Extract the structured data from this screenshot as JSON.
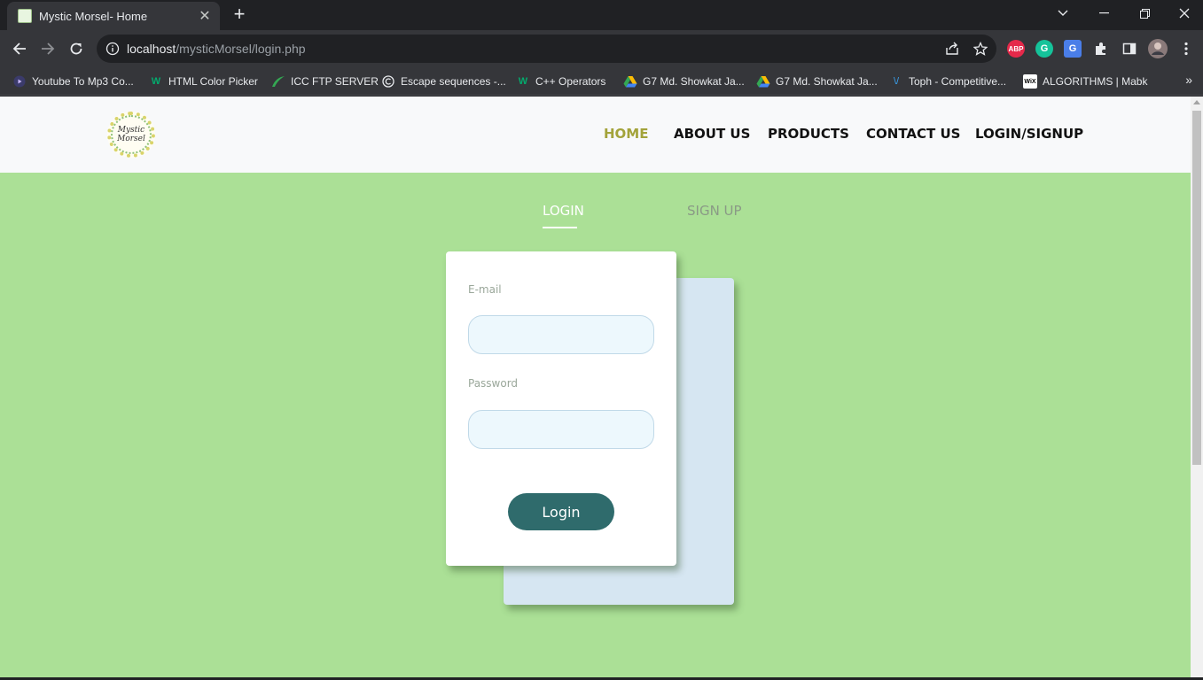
{
  "browser": {
    "tab": {
      "title": "Mystic Morsel- Home",
      "close": "✕"
    },
    "new_tab": "+",
    "url": {
      "host": "localhost",
      "path": "/mysticMorsel/login.php"
    },
    "extensions": {
      "abp": "ABP",
      "grammarly": "G",
      "translate": "G"
    },
    "bookmarks": [
      {
        "label": "Youtube To Mp3 Co...",
        "icon": "play-icon"
      },
      {
        "label": "HTML Color Picker",
        "icon": "w3schools-icon"
      },
      {
        "label": "ICC FTP SERVER",
        "icon": "leaf-icon"
      },
      {
        "label": "Escape sequences -...",
        "icon": "cplusplus-icon"
      },
      {
        "label": "C++ Operators",
        "icon": "w3schools-icon"
      },
      {
        "label": "G7 Md. Showkat Ja...",
        "icon": "drive-icon"
      },
      {
        "label": "G7 Md. Showkat Ja...",
        "icon": "drive-icon"
      },
      {
        "label": "Toph - Competitive...",
        "icon": "toph-icon"
      },
      {
        "label": "ALGORITHMS | Mabk",
        "icon": "wix-icon"
      }
    ],
    "bookmarks_more": "»"
  },
  "site": {
    "logo_text": {
      "line1": "Mystic",
      "line2": "Morsel"
    },
    "nav": [
      {
        "label": "HOME",
        "active": true
      },
      {
        "label": "ABOUT US",
        "active": false
      },
      {
        "label": "PRODUCTS",
        "active": false
      },
      {
        "label": "CONTACT US",
        "active": false
      },
      {
        "label": "LOGIN/SIGNUP",
        "active": false
      }
    ]
  },
  "auth": {
    "switch": {
      "login": "LOGIN",
      "signup": "SIGN UP",
      "active": "login"
    },
    "form": {
      "email_label": "E-mail",
      "email_value": "",
      "password_label": "Password",
      "password_value": "",
      "submit_label": "Login"
    }
  },
  "colors": {
    "page_background": "#abe096",
    "nav_active": "#a3a33a",
    "button": "#2f6b6c",
    "input_background": "#edf8fd",
    "back_card": "#d6e6f2"
  }
}
